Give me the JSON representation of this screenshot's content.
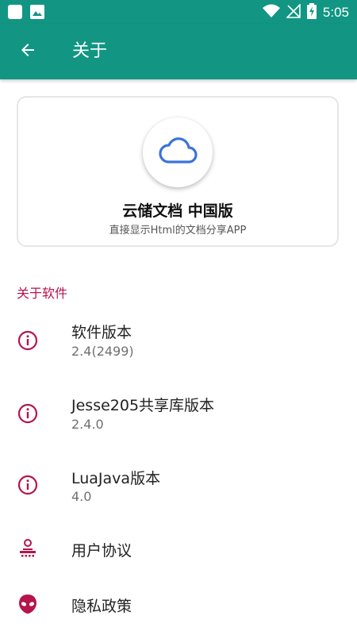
{
  "status_bar": {
    "time": "5:05",
    "icons": [
      "app-icon",
      "image-icon",
      "wifi-icon",
      "no-signal-icon",
      "battery-charging-icon"
    ]
  },
  "app_bar": {
    "title": "关于",
    "back_icon": "arrow-left-icon"
  },
  "app_card": {
    "name": "云储文档 中国版",
    "description": "直接显示Html的文档分享APP",
    "logo_icon": "cloud-icon"
  },
  "section": {
    "title": "关于软件"
  },
  "items": [
    {
      "title": "软件版本",
      "subtitle": "2.4(2499)",
      "icon": "info-icon"
    },
    {
      "title": "Jesse205共享库版本",
      "subtitle": "2.4.0",
      "icon": "info-icon"
    },
    {
      "title": "LuaJava版本",
      "subtitle": "4.0",
      "icon": "info-icon"
    },
    {
      "title": "用户协议",
      "icon": "user-agreement-icon"
    },
    {
      "title": "隐私政策",
      "icon": "privacy-alien-icon"
    }
  ],
  "colors": {
    "primary": "#129683",
    "accent": "#b5154b",
    "logo_blue": "#3b73d9"
  }
}
